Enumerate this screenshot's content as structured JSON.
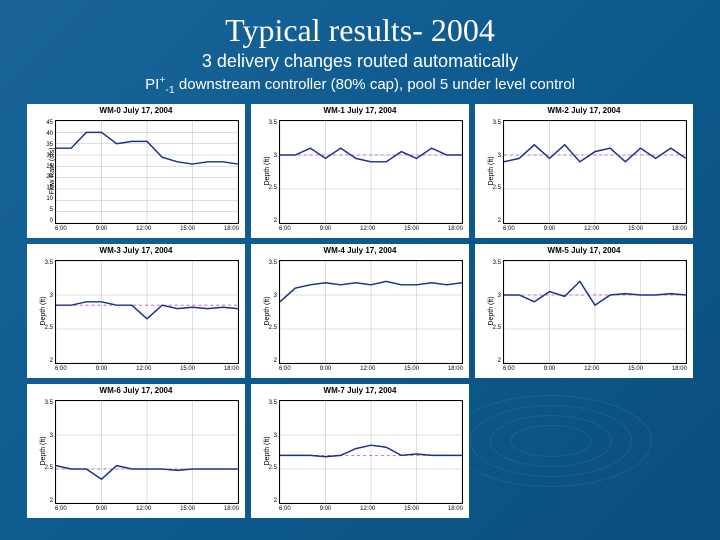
{
  "title": "Typical results- 2004",
  "subtitle1": "3 delivery changes routed automatically",
  "subtitle2_pre": "PI",
  "subtitle2_sup": "+",
  "subtitle2_sub": "-1",
  "subtitle2_post": " downstream controller (80% cap), pool 5 under level control",
  "xticks": [
    "6:00",
    "9:00",
    "12:00",
    "15:00",
    "18:00"
  ],
  "panels": [
    {
      "title": "WM-0 July 17, 2004",
      "ylabel": "Flow Rate (cfs)",
      "ylim": [
        0,
        45
      ],
      "yticks": [
        "45",
        "40",
        "35",
        "30",
        "25",
        "20",
        "15",
        "10",
        "5",
        "0"
      ],
      "ref": null
    },
    {
      "title": "WM-1 July 17, 2004",
      "ylabel": "Depth (ft)",
      "ylim": [
        2,
        3.5
      ],
      "yticks": [
        "3.5",
        "3",
        "2.5",
        "2"
      ],
      "ref": 3.0
    },
    {
      "title": "WM-2 July 17, 2004",
      "ylabel": "Depth (ft)",
      "ylim": [
        2,
        3.5
      ],
      "yticks": [
        "3.5",
        "3",
        "2.5",
        "2"
      ],
      "ref": 3.0
    },
    {
      "title": "WM-3 July 17, 2004",
      "ylabel": "Depth (ft)",
      "ylim": [
        2,
        3.5
      ],
      "yticks": [
        "3.5",
        "3",
        "2.5",
        "2"
      ],
      "ref": 2.85
    },
    {
      "title": "WM-4 July 17, 2004",
      "ylabel": "Depth (ft)",
      "ylim": [
        2,
        3.5
      ],
      "yticks": [
        "3.5",
        "3",
        "2.5",
        "2"
      ],
      "ref": null
    },
    {
      "title": "WM-5 July 17, 2004",
      "ylabel": "Depth (ft)",
      "ylim": [
        2,
        3.5
      ],
      "yticks": [
        "3.5",
        "3",
        "2.5",
        "2"
      ],
      "ref": 3.0
    },
    {
      "title": "WM-6 July 17, 2004",
      "ylabel": "Depth (ft)",
      "ylim": [
        2,
        3.5
      ],
      "yticks": [
        "3.5",
        "3",
        "2.5",
        "2"
      ],
      "ref": 2.5
    },
    {
      "title": "WM-7 July 17, 2004",
      "ylabel": "Depth (ft)",
      "ylim": [
        2,
        3.5
      ],
      "yticks": [
        "3.5",
        "3",
        "2.5",
        "2"
      ],
      "ref": 2.7
    }
  ],
  "chart_data": [
    {
      "type": "line",
      "title": "WM-0 July 17, 2004",
      "xlabel": "",
      "ylabel": "Flow Rate (cfs)",
      "x": [
        6,
        7,
        8,
        9,
        10,
        11,
        12,
        13,
        14,
        15,
        16,
        17,
        18
      ],
      "series": [
        {
          "name": "flow",
          "values": [
            33,
            33,
            40,
            40,
            35,
            36,
            36,
            29,
            27,
            26,
            27,
            27,
            26
          ]
        }
      ],
      "ylim": [
        0,
        45
      ]
    },
    {
      "type": "line",
      "title": "WM-1 July 17, 2004",
      "xlabel": "",
      "ylabel": "Depth (ft)",
      "x": [
        6,
        7,
        8,
        9,
        10,
        11,
        12,
        13,
        14,
        15,
        16,
        17,
        18
      ],
      "series": [
        {
          "name": "depth",
          "values": [
            3.0,
            3.0,
            3.1,
            2.95,
            3.1,
            2.95,
            2.9,
            2.9,
            3.05,
            2.95,
            3.1,
            3.0,
            3.0
          ]
        },
        {
          "name": "ref",
          "values": [
            3.0,
            3.0,
            3.0,
            3.0,
            3.0,
            3.0,
            3.0,
            3.0,
            3.0,
            3.0,
            3.0,
            3.0,
            3.0
          ]
        }
      ],
      "ylim": [
        2,
        3.5
      ]
    },
    {
      "type": "line",
      "title": "WM-2 July 17, 2004",
      "xlabel": "",
      "ylabel": "Depth (ft)",
      "x": [
        6,
        7,
        8,
        9,
        10,
        11,
        12,
        13,
        14,
        15,
        16,
        17,
        18
      ],
      "series": [
        {
          "name": "depth",
          "values": [
            2.9,
            2.95,
            3.15,
            2.95,
            3.15,
            2.9,
            3.05,
            3.1,
            2.9,
            3.1,
            2.95,
            3.1,
            2.95
          ]
        },
        {
          "name": "ref",
          "values": [
            3.0,
            3.0,
            3.0,
            3.0,
            3.0,
            3.0,
            3.0,
            3.0,
            3.0,
            3.0,
            3.0,
            3.0,
            3.0
          ]
        }
      ],
      "ylim": [
        2,
        3.5
      ]
    },
    {
      "type": "line",
      "title": "WM-3 July 17, 2004",
      "xlabel": "",
      "ylabel": "Depth (ft)",
      "x": [
        6,
        7,
        8,
        9,
        10,
        11,
        12,
        13,
        14,
        15,
        16,
        17,
        18
      ],
      "series": [
        {
          "name": "depth",
          "values": [
            2.85,
            2.85,
            2.9,
            2.9,
            2.85,
            2.85,
            2.65,
            2.85,
            2.8,
            2.82,
            2.8,
            2.82,
            2.8
          ]
        },
        {
          "name": "ref",
          "values": [
            2.85,
            2.85,
            2.85,
            2.85,
            2.85,
            2.85,
            2.85,
            2.85,
            2.85,
            2.85,
            2.85,
            2.85,
            2.85
          ]
        }
      ],
      "ylim": [
        2,
        3.5
      ]
    },
    {
      "type": "line",
      "title": "WM-4 July 17, 2004",
      "xlabel": "",
      "ylabel": "Depth (ft)",
      "x": [
        6,
        7,
        8,
        9,
        10,
        11,
        12,
        13,
        14,
        15,
        16,
        17,
        18
      ],
      "series": [
        {
          "name": "depth",
          "values": [
            2.9,
            3.1,
            3.15,
            3.18,
            3.15,
            3.18,
            3.15,
            3.2,
            3.15,
            3.15,
            3.18,
            3.15,
            3.18
          ]
        }
      ],
      "ylim": [
        2,
        3.5
      ]
    },
    {
      "type": "line",
      "title": "WM-5 July 17, 2004",
      "xlabel": "",
      "ylabel": "Depth (ft)",
      "x": [
        6,
        7,
        8,
        9,
        10,
        11,
        12,
        13,
        14,
        15,
        16,
        17,
        18
      ],
      "series": [
        {
          "name": "depth",
          "values": [
            3.0,
            3.0,
            2.9,
            3.05,
            2.98,
            3.2,
            2.85,
            3.0,
            3.02,
            3.0,
            3.0,
            3.02,
            3.0
          ]
        },
        {
          "name": "ref",
          "values": [
            3.0,
            3.0,
            3.0,
            3.0,
            3.0,
            3.0,
            3.0,
            3.0,
            3.0,
            3.0,
            3.0,
            3.0,
            3.0
          ]
        }
      ],
      "ylim": [
        2,
        3.5
      ]
    },
    {
      "type": "line",
      "title": "WM-6 July 17, 2004",
      "xlabel": "",
      "ylabel": "Depth (ft)",
      "x": [
        6,
        7,
        8,
        9,
        10,
        11,
        12,
        13,
        14,
        15,
        16,
        17,
        18
      ],
      "series": [
        {
          "name": "depth",
          "values": [
            2.55,
            2.5,
            2.5,
            2.35,
            2.55,
            2.5,
            2.5,
            2.5,
            2.48,
            2.5,
            2.5,
            2.5,
            2.5
          ]
        },
        {
          "name": "ref",
          "values": [
            2.5,
            2.5,
            2.5,
            2.5,
            2.5,
            2.5,
            2.5,
            2.5,
            2.5,
            2.5,
            2.5,
            2.5,
            2.5
          ]
        }
      ],
      "ylim": [
        2,
        3.5
      ]
    },
    {
      "type": "line",
      "title": "WM-7 July 17, 2004",
      "xlabel": "",
      "ylabel": "Depth (ft)",
      "x": [
        6,
        7,
        8,
        9,
        10,
        11,
        12,
        13,
        14,
        15,
        16,
        17,
        18
      ],
      "series": [
        {
          "name": "depth",
          "values": [
            2.7,
            2.7,
            2.7,
            2.68,
            2.7,
            2.8,
            2.85,
            2.82,
            2.7,
            2.72,
            2.7,
            2.7,
            2.7
          ]
        },
        {
          "name": "ref",
          "values": [
            2.7,
            2.7,
            2.7,
            2.7,
            2.7,
            2.7,
            2.7,
            2.7,
            2.7,
            2.7,
            2.7,
            2.7,
            2.7
          ]
        }
      ],
      "ylim": [
        2,
        3.5
      ]
    }
  ]
}
